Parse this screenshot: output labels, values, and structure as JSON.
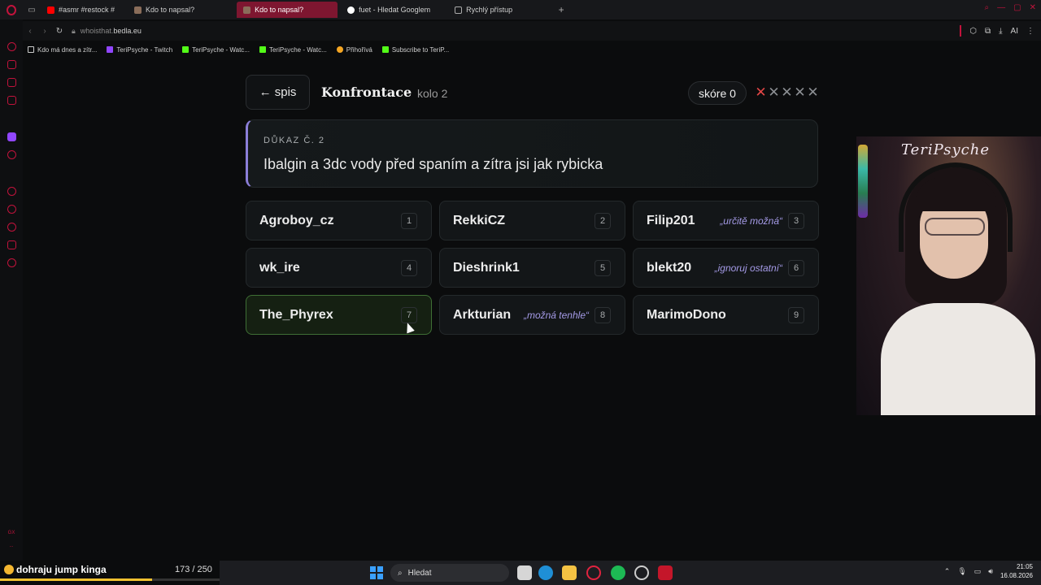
{
  "browser": {
    "tabs": [
      {
        "label": "#asmr #restock #",
        "active": false
      },
      {
        "label": "Kdo to napsal?",
        "active": false
      },
      {
        "label": "Kdo to napsal?",
        "active": true
      },
      {
        "label": "fuet - Hledat Googlem",
        "active": false
      },
      {
        "label": "Rychlý přístup",
        "active": false
      }
    ],
    "new_tab_label": "+",
    "url_domain_prefix": "whoisthat.",
    "url_domain_main": "bedla.eu",
    "ai_label": "AI",
    "bookmarks": [
      {
        "label": "Kdo má dnes a zítr...",
        "color": "#cccccc"
      },
      {
        "label": "TeriPsyche - Twitch",
        "color": "#9146ff"
      },
      {
        "label": "TeriPsyche - Watc...",
        "color": "#53fc18"
      },
      {
        "label": "TeriPsyche - Watc...",
        "color": "#53fc18"
      },
      {
        "label": "Přihořívá",
        "color": "#f5a623"
      },
      {
        "label": "Subscribe to TeriP...",
        "color": "#53fc18"
      }
    ]
  },
  "sidebar": {
    "bottom_labels": [
      "GX",
      "..."
    ]
  },
  "game": {
    "back_label": "← spis",
    "title": "Konfrontace",
    "round_label": "kolo 2",
    "score_label": "skóre 0",
    "strikes": [
      {
        "symbol": "✕",
        "active": true
      },
      {
        "symbol": "✕",
        "active": false
      },
      {
        "symbol": "✕",
        "active": false
      },
      {
        "symbol": "✕",
        "active": false
      },
      {
        "symbol": "✕",
        "active": false
      }
    ],
    "evidence": {
      "label": "DŮKAZ Č. 2",
      "text": "Ibalgin a 3dc vody před spaním a zítra jsi jak rybicka"
    },
    "suspects": [
      {
        "name": "Agroboy_cz",
        "note": "",
        "number": "1"
      },
      {
        "name": "RekkiCZ",
        "note": "",
        "number": "2"
      },
      {
        "name": "Filip201",
        "note": "„určitě možná“",
        "number": "3"
      },
      {
        "name": "wk_ire",
        "note": "",
        "number": "4"
      },
      {
        "name": "Dieshrink1",
        "note": "",
        "number": "5"
      },
      {
        "name": "blekt20",
        "note": "„ignoruj ostatní“",
        "number": "6"
      },
      {
        "name": "The_Phyrex",
        "note": "",
        "number": "7"
      },
      {
        "name": "Arkturian",
        "note": "„možná tenhle“",
        "number": "8"
      },
      {
        "name": "MarimoDono",
        "note": "",
        "number": "9"
      }
    ],
    "hovered_suspect": "7"
  },
  "stream": {
    "webcam_title": "TeriPsyche",
    "goal_text": "dohraju jump kinga",
    "goal_count": "173 / 250",
    "goal_progress": 0.692
  },
  "taskbar": {
    "search_placeholder": "Hledat",
    "time": "21:05",
    "date": "16.08.2026"
  }
}
